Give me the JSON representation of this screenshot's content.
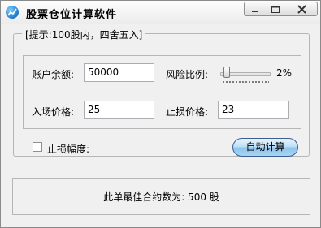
{
  "window": {
    "title": "股票仓位计算软件",
    "icon": "stock-chart-app-icon"
  },
  "group": {
    "legend": "[提示:100股内，四舍五入]"
  },
  "fields": {
    "balance_label": "账户余额:",
    "balance_value": "50000",
    "risk_label": "风险比例:",
    "risk_value": "2%",
    "risk_slider_percent": 2,
    "entry_label": "入场价格:",
    "entry_value": "25",
    "stop_label": "止损价格:",
    "stop_value": "23"
  },
  "options": {
    "stop_range_label": "止损幅度:",
    "stop_range_checked": false
  },
  "actions": {
    "calc_label": "自动计算"
  },
  "result": {
    "text": "此单最佳合约数为: 500 股"
  }
}
